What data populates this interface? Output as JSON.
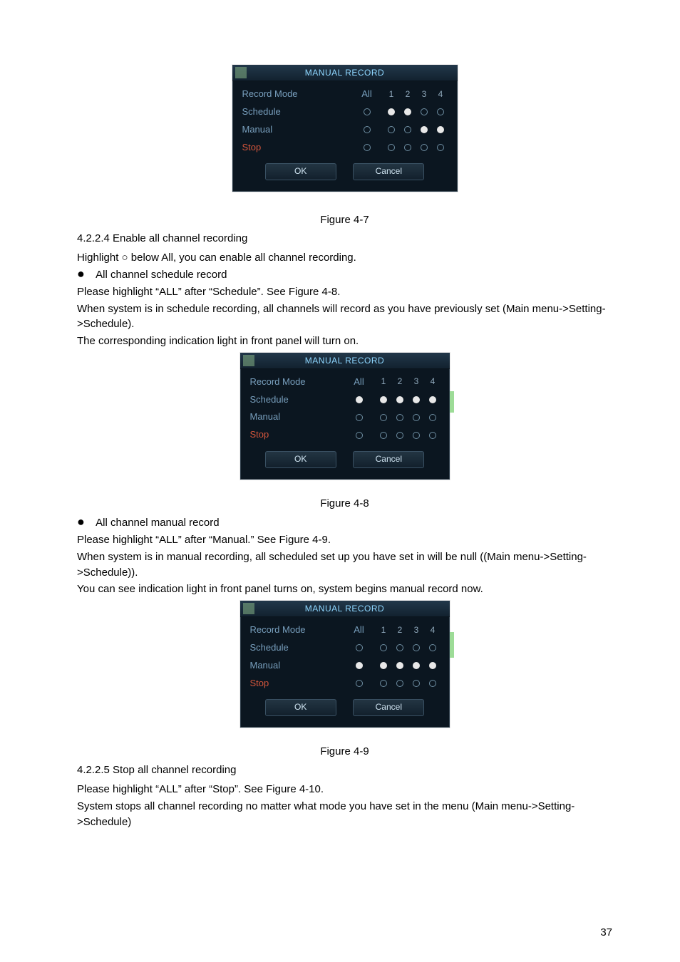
{
  "dialog": {
    "title": "MANUAL RECORD",
    "record_mode_label": "Record Mode",
    "all_label": "All",
    "ch": [
      "1",
      "2",
      "3",
      "4"
    ],
    "schedule_label": "Schedule",
    "manual_label": "Manual",
    "stop_label": "Stop",
    "ok": "OK",
    "cancel": "Cancel"
  },
  "fig7": {
    "caption": "Figure 4-7",
    "schedule_all": "o",
    "manual_all": "o",
    "stop_all": "o",
    "schedule": [
      "f",
      "f",
      "o",
      "o"
    ],
    "manual": [
      "o",
      "o",
      "f",
      "f"
    ],
    "stop": [
      "o",
      "o",
      "o",
      "o"
    ]
  },
  "sec4224": {
    "title": "4.2.2.4  Enable all channel recording",
    "p1": "Highlight ○ below All, you can enable all channel recording.",
    "bullet1": "All channel schedule record",
    "p2": "Please highlight “ALL” after “Schedule”. See Figure 4-8.",
    "p3": "When system is in schedule recording, all channels will record as you have previously set (Main menu->Setting->Schedule).",
    "p4": "The corresponding indication light in front panel will turn on."
  },
  "fig8": {
    "caption": "Figure 4-8",
    "schedule_all": "f",
    "manual_all": "o",
    "stop_all": "o",
    "schedule": [
      "f",
      "f",
      "f",
      "f"
    ],
    "manual": [
      "o",
      "o",
      "o",
      "o"
    ],
    "stop": [
      "o",
      "o",
      "o",
      "o"
    ]
  },
  "sec_mid": {
    "bullet2": "All channel manual record",
    "p5": "Please highlight “ALL” after “Manual.” See Figure 4-9.",
    "p6": "When system is in manual recording, all scheduled set up you have set in will be null ((Main menu->Setting->Schedule)).",
    "p7": "You can see indication light in front panel turns on, system begins manual record now."
  },
  "fig9": {
    "caption": "Figure 4-9",
    "schedule_all": "o",
    "manual_all": "f",
    "stop_all": "o",
    "schedule": [
      "o",
      "o",
      "o",
      "o"
    ],
    "manual": [
      "f",
      "f",
      "f",
      "f"
    ],
    "stop": [
      "o",
      "o",
      "o",
      "o"
    ]
  },
  "sec4225": {
    "title": "4.2.2.5  Stop all channel recording",
    "p8": "Please highlight “ALL” after “Stop”. See Figure 4-10.",
    "p9": "System stops all channel recording no matter what mode you have set in the menu (Main menu->Setting->Schedule)"
  },
  "page_number": "37"
}
